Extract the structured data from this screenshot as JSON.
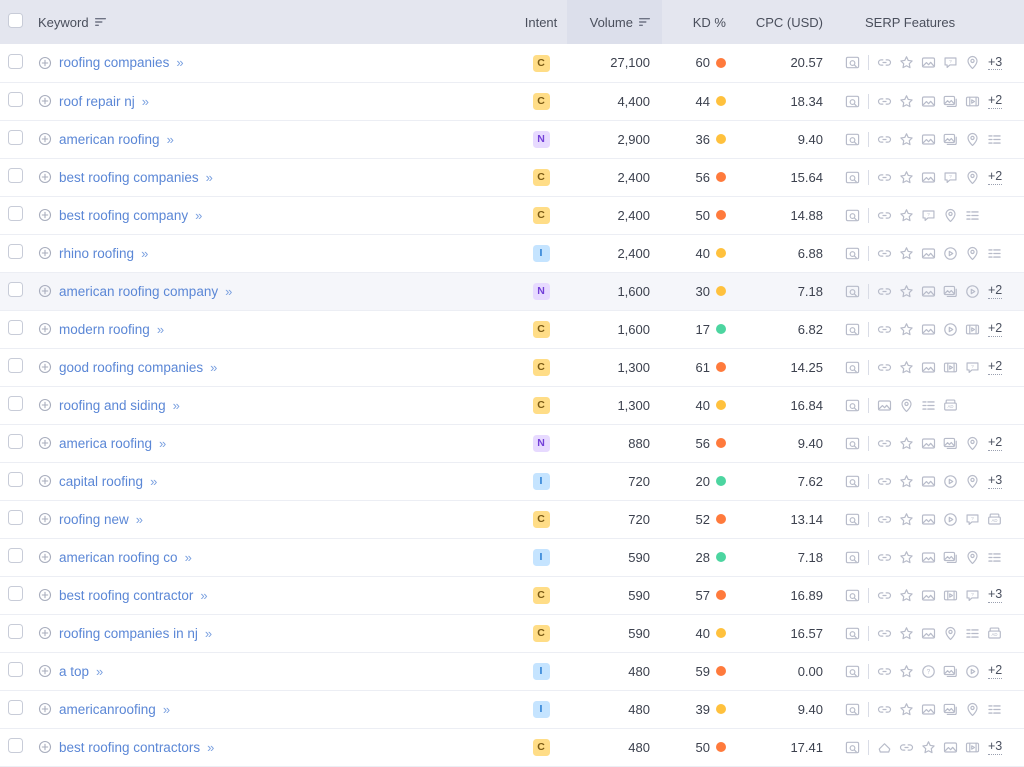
{
  "table": {
    "columns": [
      {
        "key": "checkbox",
        "label": "",
        "sortable": false
      },
      {
        "key": "keyword",
        "label": "Keyword",
        "sortable": true
      },
      {
        "key": "intent",
        "label": "Intent",
        "sortable": false
      },
      {
        "key": "volume",
        "label": "Volume",
        "sortable": true,
        "sorted": true
      },
      {
        "key": "kd",
        "label": "KD %",
        "sortable": false
      },
      {
        "key": "cpc",
        "label": "CPC (USD)",
        "sortable": false
      },
      {
        "key": "serp",
        "label": "SERP Features",
        "sortable": false
      }
    ],
    "headers": {
      "keyword": "Keyword",
      "intent": "Intent",
      "volume": "Volume",
      "kd": "KD %",
      "cpc": "CPC (USD)",
      "serp": "SERP Features"
    },
    "icons": {
      "sort": "sort-descending-icon",
      "expand": "plus-circle-icon",
      "chevron": "»",
      "checkbox": "checkbox-icon"
    },
    "colors": {
      "kd_easy": "#4cd5a0",
      "kd_medium": "#ffc13d",
      "kd_hard": "#ff7a3c",
      "intent_commercial_bg": "#ffdd87",
      "intent_navigational_bg": "#e7daff",
      "intent_informational_bg": "#c5e4ff",
      "link": "#5b87d6",
      "header_bg": "#e4e6ef",
      "sorted_header_bg": "#dcdfeb",
      "row_hover_bg": "#f5f6fa"
    },
    "rows": [
      {
        "keyword": "roofing companies",
        "chevron": "»",
        "intent": "C",
        "volume": "27,100",
        "kd": "60",
        "kd_level": "hard",
        "cpc": "20.57",
        "serp": [
          "preview",
          "sep",
          "link",
          "star",
          "image",
          "faq",
          "pin"
        ],
        "serp_more": "+3",
        "hover": false
      },
      {
        "keyword": "roof repair nj",
        "chevron": "»",
        "intent": "C",
        "volume": "4,400",
        "kd": "44",
        "kd_level": "medium",
        "cpc": "18.34",
        "serp": [
          "preview",
          "sep",
          "link",
          "star",
          "image",
          "image-stack",
          "video-box"
        ],
        "serp_more": "+2",
        "hover": false
      },
      {
        "keyword": "american roofing",
        "chevron": "»",
        "intent": "N",
        "volume": "2,900",
        "kd": "36",
        "kd_level": "medium",
        "cpc": "9.40",
        "serp": [
          "preview",
          "sep",
          "link",
          "star",
          "image",
          "image-stack",
          "pin",
          "list"
        ],
        "serp_more": "",
        "hover": false
      },
      {
        "keyword": "best roofing companies",
        "chevron": "»",
        "intent": "C",
        "volume": "2,400",
        "kd": "56",
        "kd_level": "hard",
        "cpc": "15.64",
        "serp": [
          "preview",
          "sep",
          "link",
          "star",
          "image",
          "faq",
          "pin"
        ],
        "serp_more": "+2",
        "hover": false
      },
      {
        "keyword": "best roofing company",
        "chevron": "»",
        "intent": "C",
        "volume": "2,400",
        "kd": "50",
        "kd_level": "hard",
        "cpc": "14.88",
        "serp": [
          "preview",
          "sep",
          "link",
          "star",
          "faq",
          "pin",
          "list"
        ],
        "serp_more": "",
        "hover": false
      },
      {
        "keyword": "rhino roofing",
        "chevron": "»",
        "intent": "I",
        "volume": "2,400",
        "kd": "40",
        "kd_level": "medium",
        "cpc": "6.88",
        "serp": [
          "preview",
          "sep",
          "link",
          "star",
          "image",
          "play",
          "pin",
          "list"
        ],
        "serp_more": "",
        "hover": false
      },
      {
        "keyword": "american roofing company",
        "chevron": "»",
        "intent": "N",
        "volume": "1,600",
        "kd": "30",
        "kd_level": "medium",
        "cpc": "7.18",
        "serp": [
          "preview",
          "sep",
          "link",
          "star",
          "image",
          "image-stack",
          "play"
        ],
        "serp_more": "+2",
        "hover": true
      },
      {
        "keyword": "modern roofing",
        "chevron": "»",
        "intent": "C",
        "volume": "1,600",
        "kd": "17",
        "kd_level": "easy",
        "cpc": "6.82",
        "serp": [
          "preview",
          "sep",
          "link",
          "star",
          "image",
          "play",
          "video-box"
        ],
        "serp_more": "+2",
        "hover": false
      },
      {
        "keyword": "good roofing companies",
        "chevron": "»",
        "intent": "C",
        "volume": "1,300",
        "kd": "61",
        "kd_level": "hard",
        "cpc": "14.25",
        "serp": [
          "preview",
          "sep",
          "link",
          "star",
          "image",
          "video-box",
          "faq"
        ],
        "serp_more": "+2",
        "hover": false
      },
      {
        "keyword": "roofing and siding",
        "chevron": "»",
        "intent": "C",
        "volume": "1,300",
        "kd": "40",
        "kd_level": "medium",
        "cpc": "16.84",
        "serp": [
          "preview",
          "sep",
          "image",
          "pin",
          "list",
          "ad"
        ],
        "serp_more": "",
        "hover": false
      },
      {
        "keyword": "america roofing",
        "chevron": "»",
        "intent": "N",
        "volume": "880",
        "kd": "56",
        "kd_level": "hard",
        "cpc": "9.40",
        "serp": [
          "preview",
          "sep",
          "link",
          "star",
          "image",
          "image-stack",
          "pin"
        ],
        "serp_more": "+2",
        "hover": false
      },
      {
        "keyword": "capital roofing",
        "chevron": "»",
        "intent": "I",
        "volume": "720",
        "kd": "20",
        "kd_level": "easy",
        "cpc": "7.62",
        "serp": [
          "preview",
          "sep",
          "link",
          "star",
          "image",
          "play",
          "pin"
        ],
        "serp_more": "+3",
        "hover": false
      },
      {
        "keyword": "roofing new",
        "chevron": "»",
        "intent": "C",
        "volume": "720",
        "kd": "52",
        "kd_level": "hard",
        "cpc": "13.14",
        "serp": [
          "preview",
          "sep",
          "link",
          "star",
          "image",
          "play",
          "faq",
          "ad"
        ],
        "serp_more": "",
        "hover": false
      },
      {
        "keyword": "american roofing co",
        "chevron": "»",
        "intent": "I",
        "volume": "590",
        "kd": "28",
        "kd_level": "easy",
        "cpc": "7.18",
        "serp": [
          "preview",
          "sep",
          "link",
          "star",
          "image",
          "image-stack",
          "pin",
          "list"
        ],
        "serp_more": "",
        "hover": false
      },
      {
        "keyword": "best roofing contractor",
        "chevron": "»",
        "intent": "C",
        "volume": "590",
        "kd": "57",
        "kd_level": "hard",
        "cpc": "16.89",
        "serp": [
          "preview",
          "sep",
          "link",
          "star",
          "image",
          "video-box",
          "faq"
        ],
        "serp_more": "+3",
        "hover": false
      },
      {
        "keyword": "roofing companies in nj",
        "chevron": "»",
        "intent": "C",
        "volume": "590",
        "kd": "40",
        "kd_level": "medium",
        "cpc": "16.57",
        "serp": [
          "preview",
          "sep",
          "link",
          "star",
          "image",
          "pin",
          "list",
          "ad"
        ],
        "serp_more": "",
        "hover": false
      },
      {
        "keyword": "a top",
        "chevron": "»",
        "intent": "I",
        "volume": "480",
        "kd": "59",
        "kd_level": "hard",
        "cpc": "0.00",
        "serp": [
          "preview",
          "sep",
          "link",
          "star",
          "question",
          "image-stack",
          "play"
        ],
        "serp_more": "+2",
        "hover": false
      },
      {
        "keyword": "americanroofing",
        "chevron": "»",
        "intent": "I",
        "volume": "480",
        "kd": "39",
        "kd_level": "medium",
        "cpc": "9.40",
        "serp": [
          "preview",
          "sep",
          "link",
          "star",
          "image",
          "image-stack",
          "pin",
          "list"
        ],
        "serp_more": "",
        "hover": false
      },
      {
        "keyword": "best roofing contractors",
        "chevron": "»",
        "intent": "C",
        "volume": "480",
        "kd": "50",
        "kd_level": "hard",
        "cpc": "17.41",
        "serp": [
          "preview",
          "sep",
          "reviews",
          "link",
          "star",
          "image",
          "video-box"
        ],
        "serp_more": "+3",
        "hover": false
      }
    ]
  }
}
